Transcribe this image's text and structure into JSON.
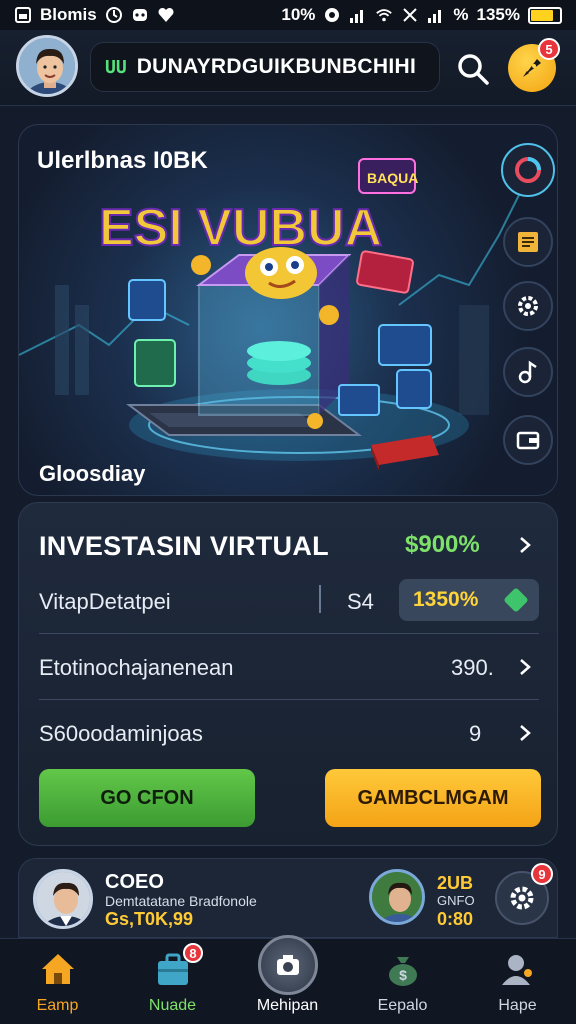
{
  "status_bar": {
    "app_name": "Blomis",
    "signal_text": "10%",
    "battery_text": "135%",
    "battery_level": 0.8
  },
  "header": {
    "search_badge": "UU",
    "title": "DUNAYRDGUIKBUNBCHIHI",
    "rocket_badge": "5"
  },
  "hero": {
    "title": "Ulerlbnas I0BK",
    "art_title": "ESI VUBUA",
    "art_tag": "BAQUA",
    "caption": "Gloosdiay"
  },
  "investment": {
    "title": "INVESTASIN VIRTUAL",
    "headline_percent": "$900%",
    "rows": [
      {
        "label": "VitapDetatpei",
        "value": "S4",
        "badge": "1350%"
      },
      {
        "label": "Etotinochajanenean",
        "value": "390."
      },
      {
        "label": "S60oodaminjoas",
        "value": "9"
      }
    ],
    "primary_button": "GO CFON",
    "secondary_button": "GAMBCLMGAM"
  },
  "profile": {
    "name": "COEO",
    "description": "Demtatatane Bradfonole",
    "amount": "Gs,T0K,99",
    "stat_top": "2UB",
    "stat_mid": "GNFO",
    "stat_bottom": "0:80",
    "settings_badge": "9"
  },
  "bottom_nav": [
    {
      "label": "Eamp",
      "color": "#f5a623",
      "active": true
    },
    {
      "label": "Nuade",
      "color": "#7ee26a",
      "badge": "8"
    },
    {
      "label": "Mehipan",
      "color": "#ffffff"
    },
    {
      "label": "Eepalo",
      "color": "#cfd6e2"
    },
    {
      "label": "Hape",
      "color": "#cfd6e2"
    }
  ],
  "colors": {
    "accent_green": "#62c749",
    "accent_yellow": "#ffc93a",
    "background": "#141c2c",
    "percent_green": "#7ee26a"
  },
  "icons": [
    "search-icon",
    "rocket-icon",
    "chart-icon",
    "note-icon",
    "gear-icon",
    "music-icon",
    "wallet-icon",
    "home-icon",
    "briefcase-icon",
    "camera-icon",
    "money-bag-icon",
    "profile-icon"
  ]
}
